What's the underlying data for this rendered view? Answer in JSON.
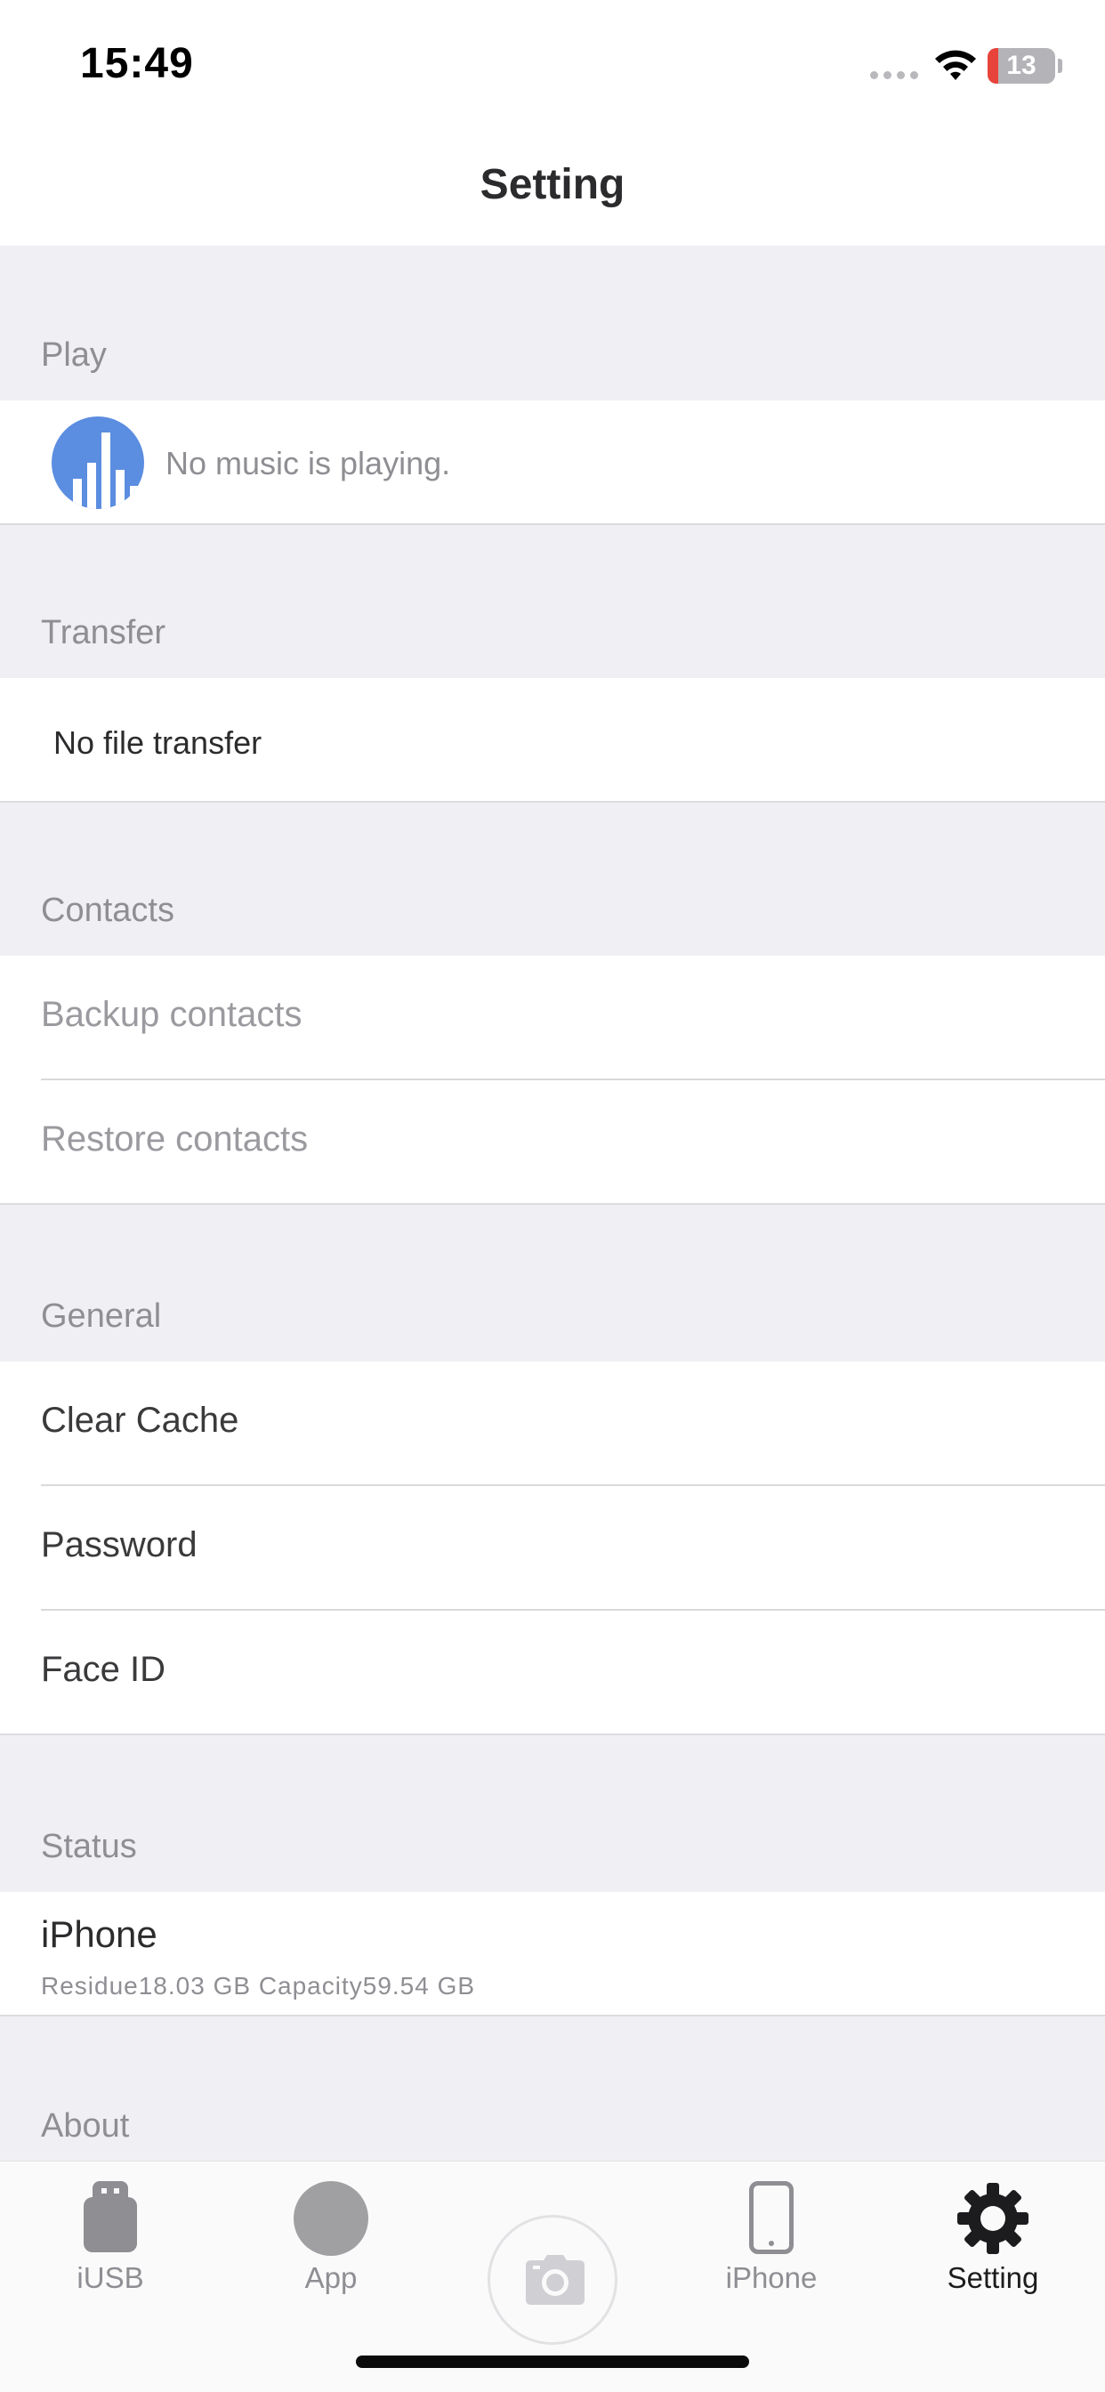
{
  "status_bar": {
    "time": "15:49",
    "battery_percent": "13",
    "battery_color_low": "#e8433a"
  },
  "nav": {
    "title": "Setting"
  },
  "sections": {
    "play": {
      "header": "Play",
      "message": "No music is playing.",
      "icon": "music-equalizer-icon",
      "icon_color": "#5b8de0"
    },
    "transfer": {
      "header": "Transfer",
      "message": "No file transfer"
    },
    "contacts": {
      "header": "Contacts",
      "items": [
        "Backup contacts",
        "Restore contacts"
      ]
    },
    "general": {
      "header": "General",
      "items": [
        "Clear Cache",
        "Password",
        "Face ID"
      ]
    },
    "status": {
      "header": "Status",
      "device": "iPhone",
      "storage": "Residue18.03 GB Capacity59.54 GB"
    },
    "about": {
      "header": "About"
    }
  },
  "tab_bar": {
    "tabs": [
      {
        "label": "iUSB",
        "icon": "usb-drive-icon"
      },
      {
        "label": "App",
        "icon": "app-circle-icon"
      },
      {
        "label": "",
        "icon": "camera-icon"
      },
      {
        "label": "iPhone",
        "icon": "phone-icon"
      },
      {
        "label": "Setting",
        "icon": "gear-icon",
        "active": true
      }
    ]
  }
}
